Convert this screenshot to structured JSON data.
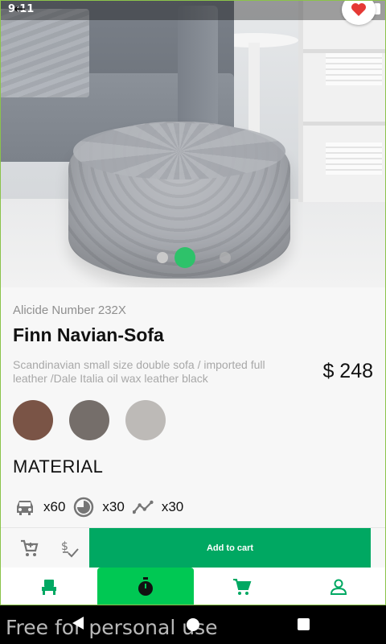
{
  "status_bar": {
    "time": "9:11"
  },
  "product": {
    "code": "Alicide Number 232X",
    "name": "Finn Navian-Sofa",
    "description": "Scandinavian small size double sofa / imported full leather /Dale Italia oil wax leather black",
    "price": "$ 248"
  },
  "carousel": {
    "total_slides": 4,
    "active_index": 1
  },
  "colors": {
    "accent": "#00a862",
    "indicator_active": "#2ec26a",
    "swatches": [
      "#7a5446",
      "#756e6a",
      "#bdbab7"
    ]
  },
  "material": {
    "heading": "MATERIAL",
    "stats": [
      {
        "icon": "car-icon",
        "value": "x60"
      },
      {
        "icon": "pie-timer-icon",
        "value": "x30"
      },
      {
        "icon": "trend-line-icon",
        "value": "x30"
      }
    ]
  },
  "actions": {
    "add_to_cart": "Add to cart"
  },
  "bottom_nav": [
    {
      "icon": "chair-icon",
      "active": false
    },
    {
      "icon": "stopwatch-icon",
      "active": true
    },
    {
      "icon": "cart-icon",
      "active": false
    },
    {
      "icon": "profile-icon",
      "active": false
    }
  ],
  "watermark": "Free for personal use"
}
